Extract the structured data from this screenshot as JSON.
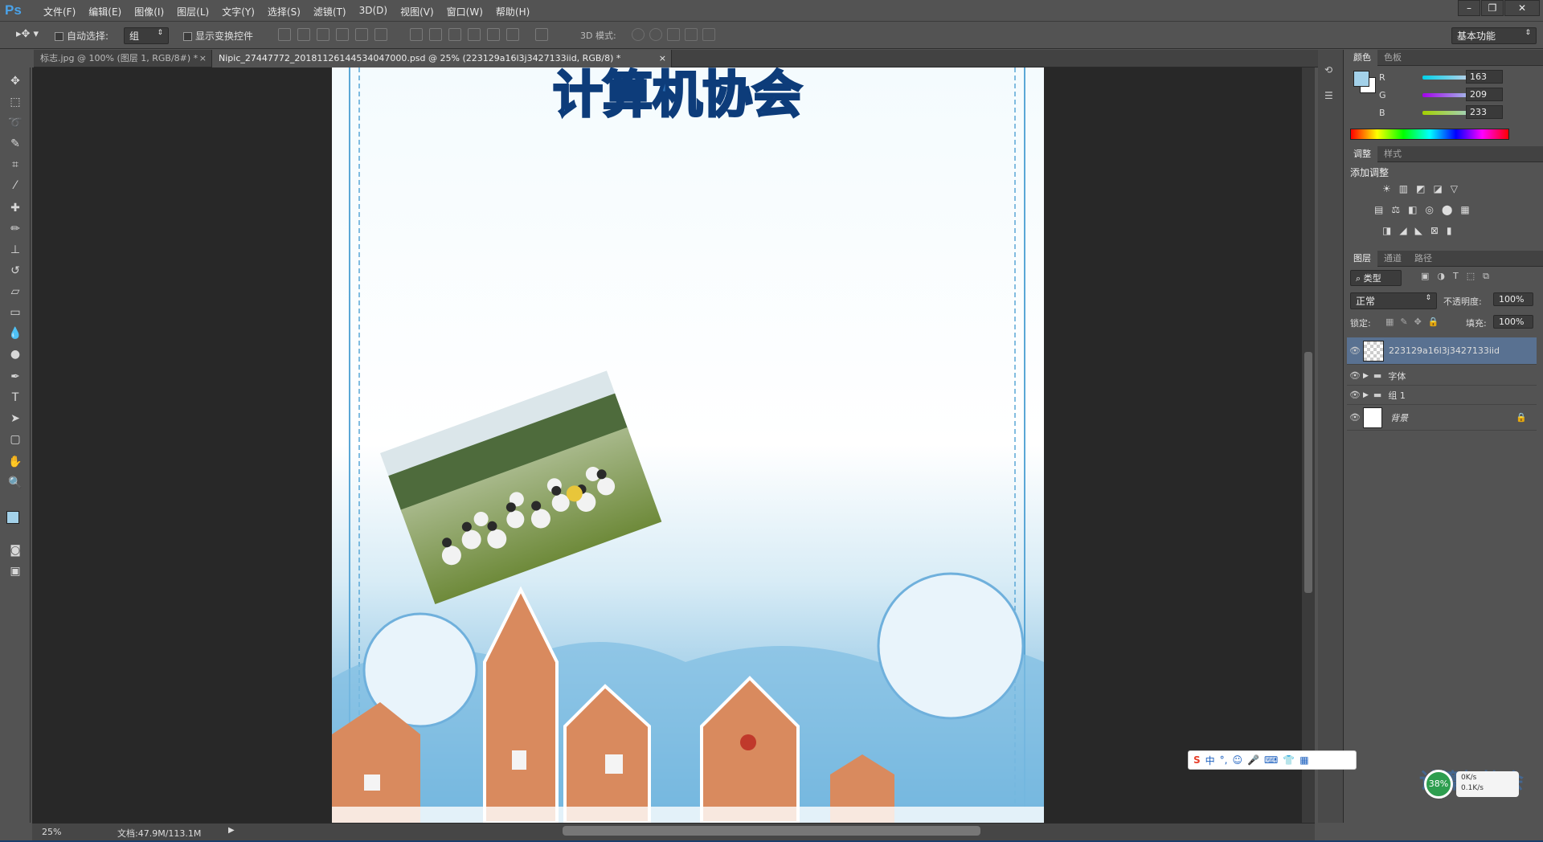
{
  "app": {
    "logo": "Ps"
  },
  "menu": [
    "文件(F)",
    "编辑(E)",
    "图像(I)",
    "图层(L)",
    "文字(Y)",
    "选择(S)",
    "滤镜(T)",
    "3D(D)",
    "视图(V)",
    "窗口(W)",
    "帮助(H)"
  ],
  "window_controls": [
    "–",
    "❐",
    "✕"
  ],
  "options": {
    "auto_select_label": "自动选择:",
    "auto_select_value": "组",
    "show_transform_label": "显示变换控件",
    "mode_3d_label": "3D 模式:",
    "workspace": "基本功能"
  },
  "tabs": [
    {
      "label": "标志.jpg @ 100% (图层 1, RGB/8#) *",
      "close": "×"
    },
    {
      "label": "Nipic_27447772_20181126144534047000.psd @ 25% (223129a16l3j3427133iid, RGB/8) *",
      "close": "×"
    }
  ],
  "canvas": {
    "title_text": "计算机协会"
  },
  "status": {
    "zoom": "25%",
    "doc_size": "文档:47.9M/113.1M"
  },
  "color_panel": {
    "tabs": [
      "颜色",
      "色板"
    ],
    "r_label": "R",
    "r_value": "163",
    "g_label": "G",
    "g_value": "209",
    "b_label": "B",
    "b_value": "233",
    "fg_color": "#a3d1e9"
  },
  "adjust_panel": {
    "tabs": [
      "调整",
      "样式"
    ],
    "title": "添加调整"
  },
  "layers_panel": {
    "tabs": [
      "图层",
      "通道",
      "路径"
    ],
    "filter_kind": "类型",
    "blend_mode": "正常",
    "opacity_label": "不透明度:",
    "opacity_value": "100%",
    "lock_label": "锁定:",
    "fill_label": "填充:",
    "fill_value": "100%",
    "layers": [
      {
        "name": "223129a16l3j3427133iid",
        "type": "smart"
      },
      {
        "name": "字体",
        "type": "group"
      },
      {
        "name": "组 1",
        "type": "group"
      },
      {
        "name": "背景",
        "type": "background"
      }
    ]
  },
  "ime": {
    "mode": "中"
  },
  "net_widget": {
    "percent": "38%",
    "up": "0K/s",
    "down": "0.1K/s"
  },
  "watermark": "计算机协会"
}
